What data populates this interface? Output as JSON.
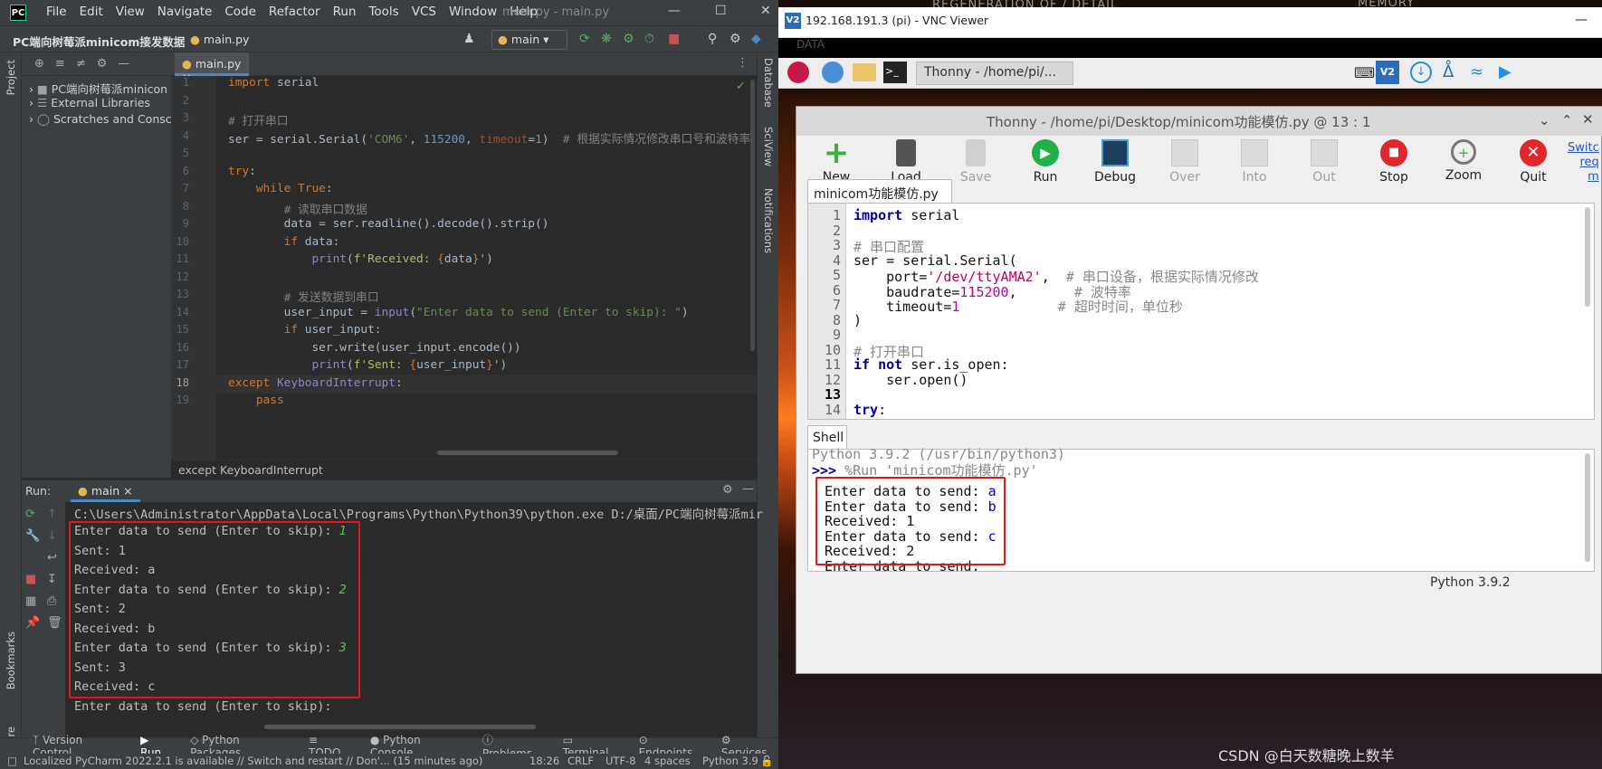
{
  "pycharm": {
    "logo": "PC",
    "menu": [
      "File",
      "Edit",
      "View",
      "Navigate",
      "Code",
      "Refactor",
      "Run",
      "Tools",
      "VCS",
      "Window",
      "Help"
    ],
    "window_title": "main.py - main.py",
    "project_crumb": "PC端向树莓派minicom接发数据",
    "file_crumb": "main.py",
    "branch": "main",
    "left_tabs": {
      "project": "Project",
      "bookmarks": "Bookmarks",
      "structure": "Structure"
    },
    "right_tabs": {
      "database": "Database",
      "sciview": "SciView",
      "notifications": "Notifications"
    },
    "tree": [
      {
        "label": "PC端向树莓派minicon",
        "icon": "folder-icon"
      },
      {
        "label": "External Libraries",
        "icon": "library-icon"
      },
      {
        "label": "Scratches and Consc",
        "icon": "scratch-icon"
      }
    ],
    "editor_tab": "main.py",
    "line_numbers": [
      "1",
      "2",
      "3",
      "4",
      "5",
      "6",
      "7",
      "8",
      "9",
      "10",
      "11",
      "12",
      "13",
      "14",
      "15",
      "16",
      "17",
      "18",
      "19"
    ],
    "breadcrumb_status": "except KeyboardInterrupt",
    "run": {
      "label": "Run:",
      "config": "main",
      "command": "C:\\Users\\Administrator\\AppData\\Local\\Programs\\Python\\Python39\\python.exe D:/桌面/PC端向树莓派mir",
      "lines": [
        {
          "text": "Enter data to send (Enter to skip): ",
          "input": "1"
        },
        {
          "text": "Sent: 1"
        },
        {
          "text": "Received: a"
        },
        {
          "text": "Enter data to send (Enter to skip): ",
          "input": "2"
        },
        {
          "text": "Sent: 2"
        },
        {
          "text": "Received: b"
        },
        {
          "text": "Enter data to send (Enter to skip): ",
          "input": "3"
        },
        {
          "text": "Sent: 3"
        },
        {
          "text": "Received: c"
        },
        {
          "text": "Enter data to send (Enter to skip): "
        }
      ]
    },
    "tool_windows": [
      "Version Control",
      "Run",
      "Python Packages",
      "TODO",
      "Python Console",
      "Problems",
      "Terminal",
      "Endpoints",
      "Services"
    ],
    "status": {
      "message": "Localized PyCharm 2022.2.1 is available // Switch and restart // Don'... (15 minutes ago)",
      "position": "18:26",
      "line_sep": "CRLF",
      "encoding": "UTF-8",
      "indent": "4 spaces",
      "interpreter": "Python 3.9"
    }
  },
  "vnc": {
    "badge": "V2",
    "title": "192.168.191.3 (pi) - VNC Viewer",
    "bg_text_1": "DATA",
    "bg_text_2": "REGENERATION OF / DETAIL",
    "bg_text_3": "MEMORY",
    "taskbar_app": "Thonny  -  /home/pi/...",
    "thonny": {
      "title": "Thonny  -  /home/pi/Desktop/minicom功能模仿.py  @  13 : 1",
      "toolbar": [
        {
          "label": "New",
          "enabled": true
        },
        {
          "label": "Load",
          "enabled": true
        },
        {
          "label": "Save",
          "enabled": false
        },
        {
          "label": "Run",
          "enabled": true
        },
        {
          "label": "Debug",
          "enabled": true
        },
        {
          "label": "Over",
          "enabled": false
        },
        {
          "label": "Into",
          "enabled": false
        },
        {
          "label": "Out",
          "enabled": false
        },
        {
          "label": "Stop",
          "enabled": true
        },
        {
          "label": "Zoom",
          "enabled": true
        },
        {
          "label": "Quit",
          "enabled": true
        }
      ],
      "switch_label_1": "Switc",
      "switch_label_2": "req",
      "switch_label_3": "m",
      "editor_tab": "minicom功能模仿.py",
      "line_numbers": [
        "1",
        "2",
        "3",
        "4",
        "5",
        "6",
        "7",
        "8",
        "9",
        "10",
        "11",
        "12",
        "13",
        "14"
      ],
      "shell_tab": "Shell",
      "shell": {
        "banner": "Python 3.9.2 (/usr/bin/python3)",
        "prompt": ">>>",
        "run_cmd": " %Run 'minicom功能模仿.py'",
        "lines": [
          {
            "text": "Enter data to send: ",
            "input": "a"
          },
          {
            "text": "Enter data to send: ",
            "input": "b"
          },
          {
            "text": "Received: 1"
          },
          {
            "text": "Enter data to send: ",
            "input": "c"
          },
          {
            "text": "Received: 2"
          },
          {
            "text": "Enter data to send:"
          }
        ]
      },
      "python_version": "Python 3.9.2"
    },
    "watermark": "CSDN @白天数糖晚上数羊"
  }
}
